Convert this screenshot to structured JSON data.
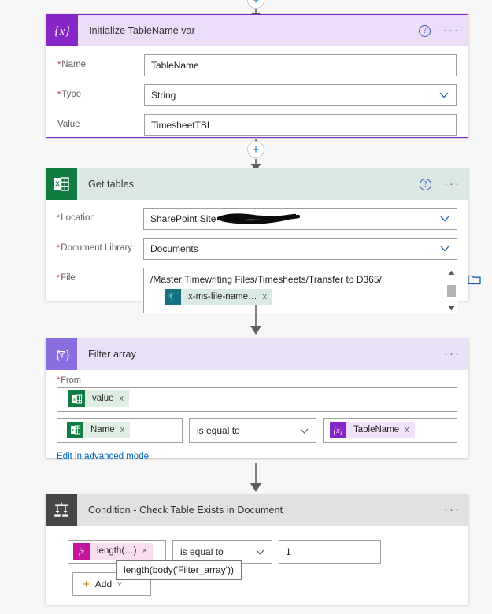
{
  "canvas": {
    "background": "#f7f7f7"
  },
  "connectors": {
    "top_plus_label": "+",
    "mid_plus_label": "+"
  },
  "cards": [
    {
      "id": "initialize-variable",
      "title": "Initialize TableName var",
      "icon": "variable-braces-icon",
      "icon_glyph": "{x}",
      "header_bg": "#ecdcf8",
      "icon_bg": "#8626c6",
      "selected": true,
      "help_label": "?",
      "menu_label": "···",
      "fields": [
        {
          "label": "Name",
          "required": true,
          "value": "TableName",
          "type": "text"
        },
        {
          "label": "Type",
          "required": true,
          "value": "String",
          "type": "select"
        },
        {
          "label": "Value",
          "required": false,
          "value": "TimesheetTBL",
          "type": "text"
        }
      ]
    },
    {
      "id": "get-tables",
      "title": "Get tables",
      "icon": "excel-icon",
      "icon_glyph": "X",
      "header_bg": "#dbe8e2",
      "icon_bg": "#107c41",
      "selected": false,
      "help_label": "?",
      "menu_label": "···",
      "fields": [
        {
          "label": "Location",
          "required": true,
          "value": "SharePoint Site",
          "type": "select-redacted"
        },
        {
          "label": "Document Library",
          "required": true,
          "value": "Documents",
          "type": "select"
        },
        {
          "label": "File",
          "required": true,
          "value": "/Master Timewriting Files/Timesheets/Transfer to D365/",
          "type": "filepicker",
          "token": {
            "label": "x-ms-file-name…",
            "icon": "sharepoint-icon",
            "icon_glyph": "s",
            "close_label": "x"
          },
          "folder_button": "folder-icon"
        }
      ]
    },
    {
      "id": "filter-array",
      "title": "Filter array",
      "icon": "filter-braces-icon",
      "icon_glyph": "{∇}",
      "header_bg": "#e8e1f8",
      "icon_bg": "#8a6ee0",
      "selected": false,
      "menu_label": "···",
      "from_label": "From",
      "from_token": {
        "label": "value",
        "icon": "excel-icon",
        "icon_glyph": "X",
        "close_label": "x"
      },
      "condition": {
        "left_token": {
          "label": "Name",
          "icon": "excel-icon",
          "icon_glyph": "X",
          "close_label": "x"
        },
        "operator": "is equal to",
        "right_token": {
          "label": "TableName",
          "icon": "variable-braces-icon",
          "icon_glyph": "{x}",
          "close_label": "x"
        }
      },
      "advanced_link": "Edit in advanced mode"
    },
    {
      "id": "condition-check-table",
      "title": "Condition - Check Table Exists in Document",
      "icon": "condition-branch-icon",
      "icon_glyph": "",
      "header_bg": "#e1e1e1",
      "icon_bg": "#484644",
      "selected": false,
      "menu_label": "···",
      "condition": {
        "left_token": {
          "label": "length(…)",
          "icon": "function-fx-icon",
          "icon_glyph": "fx",
          "close_label": "×"
        },
        "operator": "is equal to",
        "right_value": "1"
      },
      "add_button": {
        "label": "Add",
        "plus": "+",
        "chevron": "˅"
      },
      "tooltip": "length(body('Filter_array'))"
    }
  ]
}
